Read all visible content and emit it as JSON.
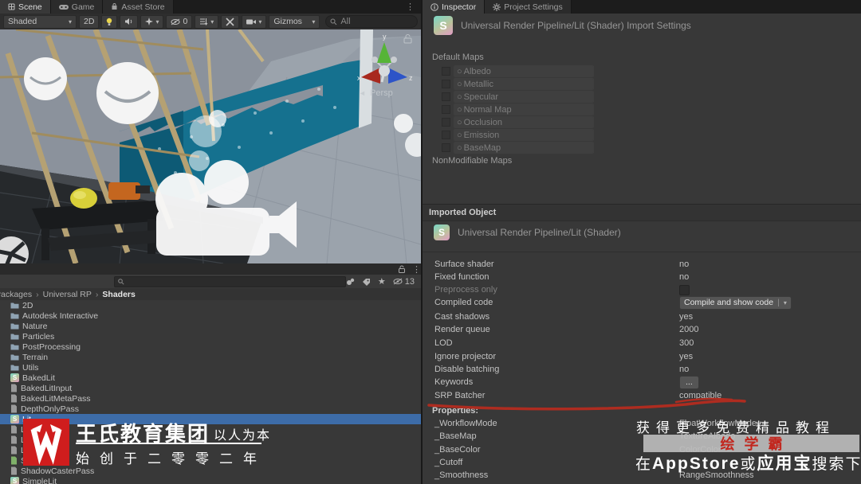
{
  "scene": {
    "tabs": {
      "scene": "Scene",
      "game": "Game",
      "asset_store": "Asset Store"
    },
    "toolbar": {
      "shading_mode": "Shaded",
      "toggle_2d": "2D",
      "effects_count": "0",
      "gizmos": "Gizmos",
      "search_value": "All"
    },
    "viewport": {
      "persp": "Persp",
      "axis_x": "x",
      "axis_y": "y",
      "axis_z": "z"
    },
    "footer": {
      "hidden_count": "13"
    }
  },
  "project": {
    "breadcrumb": {
      "root": "Packages",
      "mid": "Universal RP",
      "leaf": "Shaders"
    },
    "items": [
      {
        "label": "2D"
      },
      {
        "label": "Autodesk Interactive"
      },
      {
        "label": "Nature"
      },
      {
        "label": "Particles"
      },
      {
        "label": "PostProcessing"
      },
      {
        "label": "Terrain"
      },
      {
        "label": "Utils"
      },
      {
        "label": "BakedLit"
      },
      {
        "label": "BakedLitInput"
      },
      {
        "label": "BakedLitMetaPass"
      },
      {
        "label": "DepthOnlyPass"
      },
      {
        "label": "Lit"
      },
      {
        "label": "Lit"
      },
      {
        "label": "Lit"
      },
      {
        "label": "Lit"
      },
      {
        "label": "Sh"
      },
      {
        "label": "ShadowCasterPass"
      },
      {
        "label": "SimpleLit"
      }
    ]
  },
  "inspector": {
    "tabs": {
      "inspector": "Inspector",
      "project_settings": "Project Settings"
    },
    "import_title": "Universal Render Pipeline/Lit (Shader) Import Settings",
    "default_maps_title": "Default Maps",
    "default_maps": [
      {
        "label": "Albedo"
      },
      {
        "label": "Metallic"
      },
      {
        "label": "Specular"
      },
      {
        "label": "Normal Map"
      },
      {
        "label": "Occlusion"
      },
      {
        "label": "Emission"
      },
      {
        "label": "BaseMap"
      }
    ],
    "nonmodifiable_title": "NonModifiable Maps",
    "imported_object_title": "Imported Object",
    "shader_title": "Universal Render Pipeline/Lit (Shader)",
    "rows": [
      {
        "label": "Surface shader",
        "value": "no"
      },
      {
        "label": "Fixed function",
        "value": "no"
      },
      {
        "label": "Preprocess only",
        "value": ""
      },
      {
        "label": "Compiled code",
        "value": "Compile and show code"
      },
      {
        "label": "Cast shadows",
        "value": "yes"
      },
      {
        "label": "Render queue",
        "value": "2000"
      },
      {
        "label": "LOD",
        "value": "300"
      },
      {
        "label": "Ignore projector",
        "value": "yes"
      },
      {
        "label": "Disable batching",
        "value": "no"
      },
      {
        "label": "Keywords",
        "value": "..."
      },
      {
        "label": "SRP Batcher",
        "value": "compatible"
      }
    ],
    "properties_title": "Properties:",
    "properties": [
      {
        "name": "_WorkflowMode",
        "value": "FloatWorkflowMode"
      },
      {
        "name": "_BaseMap",
        "value": "TextureAlbedo"
      },
      {
        "name": "_BaseColor",
        "value": "ColorColor"
      },
      {
        "name": "_Cutoff",
        "value": ""
      },
      {
        "name": "_Smoothness",
        "value": "RangeSmoothness"
      }
    ]
  },
  "watermark_left": {
    "company": "王氏教育集团",
    "motto": "以人为本",
    "founded": "始创于二零零二年"
  },
  "watermark_right": {
    "line1": "获得更多免费精品教程",
    "brand": "绘学霸",
    "l3_pre": "在",
    "l3_b1": "AppStore",
    "l3_mid": "或",
    "l3_b2": "应用宝",
    "l3_post": "搜索下载"
  },
  "colors": {
    "selection_blue": "#3d6ca8",
    "underline_red": "#ae2c20",
    "logo_red": "#cf1d1d"
  }
}
